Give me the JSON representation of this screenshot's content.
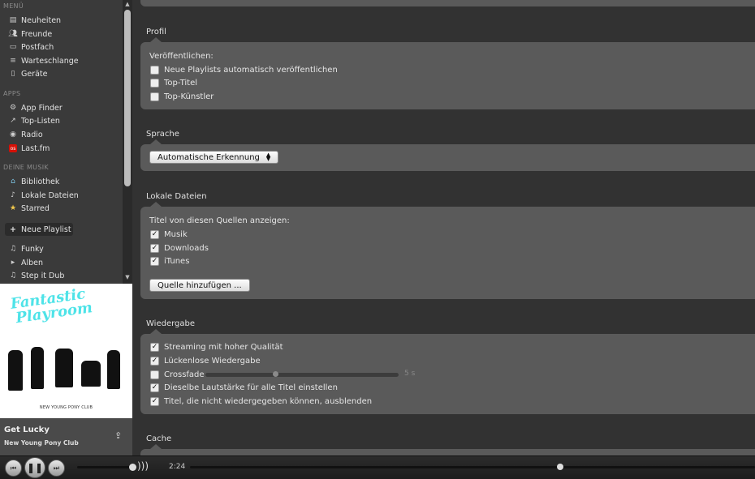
{
  "sidebar": {
    "sections": [
      {
        "heading": "MENÜ",
        "items": [
          {
            "label": "Neuheiten",
            "icon": "news-icon"
          },
          {
            "label": "Freunde",
            "icon": "friends-icon"
          },
          {
            "label": "Postfach",
            "icon": "inbox-icon"
          },
          {
            "label": "Warteschlange",
            "icon": "queue-icon"
          },
          {
            "label": "Geräte",
            "icon": "devices-icon"
          }
        ]
      },
      {
        "heading": "APPS",
        "items": [
          {
            "label": "App Finder",
            "icon": "app-finder-icon"
          },
          {
            "label": "Top-Listen",
            "icon": "toplists-icon"
          },
          {
            "label": "Radio",
            "icon": "radio-icon"
          },
          {
            "label": "Last.fm",
            "icon": "lastfm-icon"
          }
        ]
      },
      {
        "heading": "DEINE MUSIK",
        "items": [
          {
            "label": "Bibliothek",
            "icon": "library-icon"
          },
          {
            "label": "Lokale Dateien",
            "icon": "local-files-icon"
          },
          {
            "label": "Starred",
            "icon": "star-icon"
          }
        ]
      }
    ],
    "new_playlist": "Neue Playlist",
    "playlists": [
      {
        "label": "Funky",
        "icon": "music-note-icon"
      },
      {
        "label": "Alben",
        "icon": "folder-arrow-icon"
      },
      {
        "label": "Step it Dub",
        "icon": "music-note-icon"
      }
    ]
  },
  "album_art": {
    "title_line1": "Fantastic",
    "title_line2": "Playroom",
    "band": "NEW YOUNG PONY CLUB"
  },
  "now_playing": {
    "track": "Get Lucky",
    "artist": "New Young Pony Club"
  },
  "settings": {
    "profil": {
      "title": "Profil",
      "subtitle": "Veröffentlichen:",
      "options": [
        {
          "label": "Neue Playlists automatisch veröffentlichen",
          "checked": false
        },
        {
          "label": "Top-Titel",
          "checked": false
        },
        {
          "label": "Top-Künstler",
          "checked": false
        }
      ]
    },
    "sprache": {
      "title": "Sprache",
      "selected": "Automatische Erkennung"
    },
    "lokale_dateien": {
      "title": "Lokale Dateien",
      "subtitle": "Titel von diesen Quellen anzeigen:",
      "options": [
        {
          "label": "Musik",
          "checked": true
        },
        {
          "label": "Downloads",
          "checked": true
        },
        {
          "label": "iTunes",
          "checked": true
        }
      ],
      "button": "Quelle hinzufügen ..."
    },
    "wiedergabe": {
      "title": "Wiedergabe",
      "options": [
        {
          "label": "Streaming mit hoher Qualität",
          "checked": true
        },
        {
          "label": "Lückenlose Wiedergabe",
          "checked": true
        },
        {
          "label": "Crossfade",
          "checked": false
        },
        {
          "label": "Dieselbe Lautstärke für alle Titel einstellen",
          "checked": true
        },
        {
          "label": "Titel, die nicht wiedergegeben können, ausblenden",
          "checked": true
        }
      ],
      "crossfade_value": "5 s",
      "crossfade_fraction": 0.36
    },
    "cache": {
      "title": "Cache"
    }
  },
  "player": {
    "time": "2:24",
    "volume_fraction": 0.95,
    "progress_fraction": 0.65,
    "checkmark": "✓"
  }
}
